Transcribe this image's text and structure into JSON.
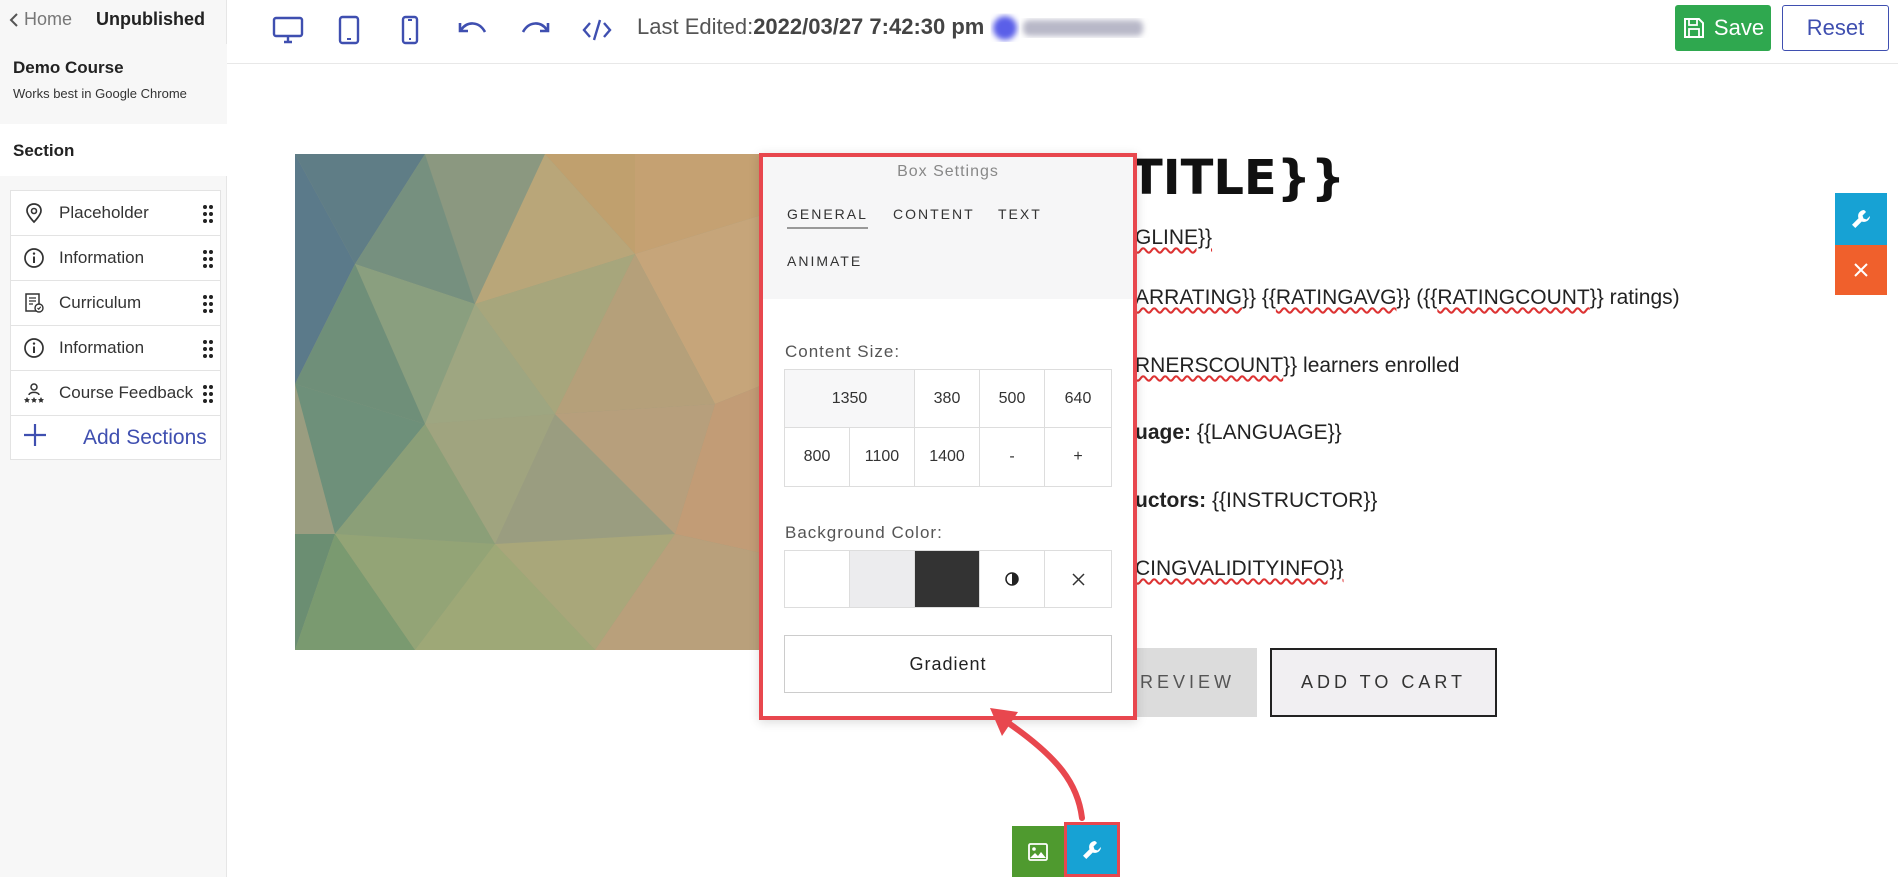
{
  "sidebar": {
    "home_label": "Home",
    "status": "Unpublished",
    "course_title": "Demo Course",
    "course_subtitle": "Works best in Google Chrome",
    "section_heading": "Section",
    "items": [
      {
        "label": "Placeholder",
        "icon": "map-pin-icon"
      },
      {
        "label": "Information",
        "icon": "info-circle-icon"
      },
      {
        "label": "Curriculum",
        "icon": "curriculum-icon"
      },
      {
        "label": "Information",
        "icon": "info-circle-icon"
      },
      {
        "label": "Course Feedback",
        "icon": "feedback-icon"
      }
    ],
    "add_sections_label": "Add Sections"
  },
  "toolbar": {
    "last_edited_label": "Last Edited:",
    "last_edited_value": "2022/03/27 7:42:30 pm",
    "save_label": "Save",
    "reset_label": "Reset",
    "icons": [
      "desktop-icon",
      "tablet-icon",
      "mobile-icon",
      "undo-icon",
      "redo-icon",
      "code-icon"
    ]
  },
  "content": {
    "heading": "TITLE}}",
    "tagline": "GLINE}}",
    "rating_parts": [
      "ARRATING",
      "}} {{",
      "RATINGAVG",
      "}} ({{",
      "RATINGCOUNT",
      "}} ratings)"
    ],
    "learners_parts": [
      "RNERSCOUNT",
      "}} learners enrolled"
    ],
    "language_label": "uage:",
    "language_value": "{{LANGUAGE}}",
    "instructors_label": "uctors:",
    "instructors_value": "{{INSTRUCTOR}}",
    "validity": "CINGVALIDITYINFO}}",
    "preview_label": "REVIEW",
    "cart_label": "ADD TO CART"
  },
  "box_settings": {
    "title": "Box Settings",
    "tabs": [
      "GENERAL",
      "CONTENT",
      "TEXT",
      "ANIMATE"
    ],
    "active_tab": "GENERAL",
    "content_size_label": "Content Size:",
    "sizes_row1": [
      "1350",
      "380",
      "500",
      "640"
    ],
    "sizes_row2": [
      "800",
      "1100",
      "1400",
      "-",
      "+"
    ],
    "background_label": "Background Color:",
    "swatches": [
      "#ffffff",
      "#ececee",
      "#333333"
    ],
    "gradient_label": "Gradient"
  },
  "colors": {
    "accent_blue": "#3f4fb0",
    "save_green": "#2fa84f",
    "wrench_cyan": "#17a2d4",
    "close_orange": "#f0602c",
    "highlight_red": "#e8474e"
  }
}
